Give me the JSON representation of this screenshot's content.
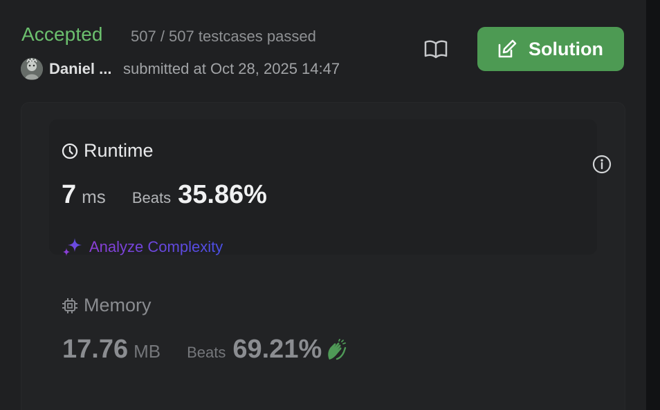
{
  "header": {
    "status": "Accepted",
    "testcases": "507 / 507 testcases passed",
    "username": "Daniel ...",
    "submitted": "submitted at Oct 28, 2025 14:47",
    "solution_label": "Solution"
  },
  "runtime": {
    "title": "Runtime",
    "value": "7",
    "unit": "ms",
    "beats_label": "Beats",
    "beats_value": "35.86%",
    "analyze_label": "Analyze Complexity"
  },
  "memory": {
    "title": "Memory",
    "value": "17.76",
    "unit": "MB",
    "beats_label": "Beats",
    "beats_value": "69.21%"
  },
  "colors": {
    "accepted": "#6cc06e",
    "solution_button": "#4d9a53",
    "analyze_gradient_start": "#8d3fd7",
    "analyze_gradient_end": "#4a4fe4"
  },
  "icons": {
    "book": "book-open-icon",
    "solution": "edit-icon",
    "runtime": "clock-icon",
    "info": "info-icon",
    "memory": "chip-icon",
    "analyze": "sparkle-icon",
    "clap": "clapping-hands-icon"
  }
}
